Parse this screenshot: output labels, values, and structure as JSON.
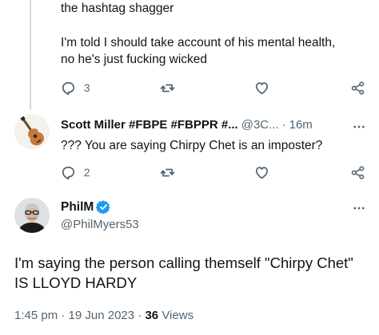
{
  "prev_tweet": {
    "line1": "the hashtag shagger",
    "line2": "I'm told I should take account of his mental health,",
    "line3": "no he's just fucking wicked",
    "reply_count": "3"
  },
  "reply_tweet": {
    "name": "Scott Miller #FBPE #FBPPR #...",
    "handle": "@3C...",
    "separator": "·",
    "time": "16m",
    "text": "??? You are saying Chirpy Chet is an imposter?",
    "reply_count": "2"
  },
  "main_tweet": {
    "name": "PhilM",
    "handle": "@PhilMyers53",
    "text_line1": "I'm saying the person calling themself \"Chirpy Chet\"",
    "text_line2": "IS LLOYD HARDY",
    "time": "1:45 pm",
    "separator": "·",
    "date": "19 Jun 2023",
    "views_count": "36",
    "views_label": "Views"
  },
  "icons": {
    "reply": "reply-icon",
    "retweet": "retweet-icon",
    "like": "heart-icon",
    "share": "share-icon",
    "more": "more-icon",
    "verified": "verified-badge-icon"
  },
  "colors": {
    "text": "#0f1419",
    "secondary": "#536471",
    "verified": "#1d9bf0",
    "thread_line": "#cfd9de"
  }
}
